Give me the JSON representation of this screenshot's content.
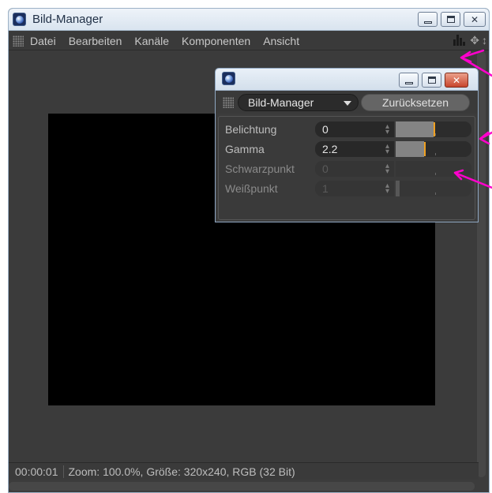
{
  "main_window": {
    "title": "Bild-Manager",
    "menu": [
      "Datei",
      "Bearbeiten",
      "Kanäle",
      "Komponenten",
      "Ansicht"
    ],
    "status": {
      "time": "00:00:01",
      "info": "Zoom: 100.0%, Größe: 320x240, RGB (32 Bit)"
    }
  },
  "popup": {
    "mode_select": "Bild-Manager",
    "reset_label": "Zurücksetzen",
    "params": [
      {
        "label": "Belichtung",
        "value": "0",
        "level": 0.5,
        "enabled": true
      },
      {
        "label": "Gamma",
        "value": "2.2",
        "level": 0.37,
        "enabled": true
      },
      {
        "label": "Schwarzpunkt",
        "value": "0",
        "level": 0.0,
        "enabled": false
      },
      {
        "label": "Weißpunkt",
        "value": "1",
        "level": 0.05,
        "enabled": false
      }
    ]
  },
  "colors": {
    "annotation": "#ff00cc",
    "slider_knob": "#f0a020",
    "panel_bg": "#3a3a3a"
  },
  "icons": [
    "app-icon",
    "histogram-icon",
    "move-icon",
    "updown-icon",
    "grip-icon",
    "dropdown-caret-icon",
    "minimize-icon",
    "maximize-icon",
    "close-icon"
  ]
}
